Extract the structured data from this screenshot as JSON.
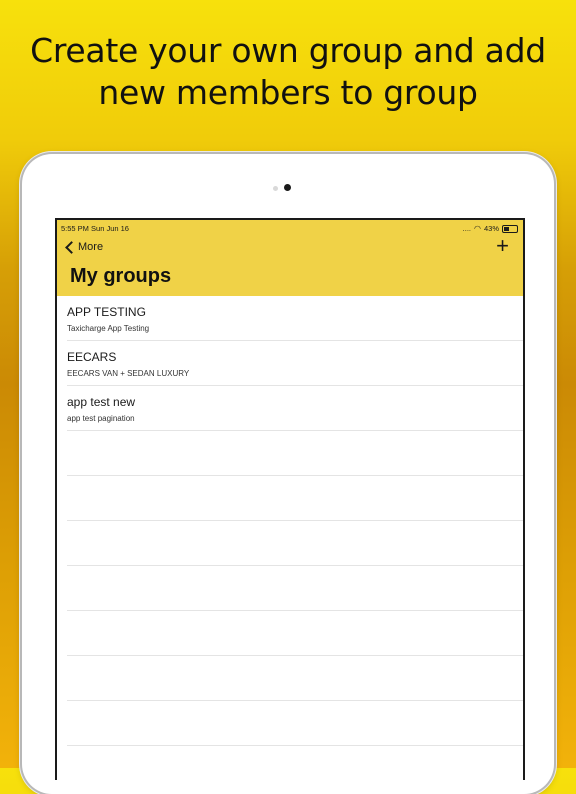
{
  "promo": {
    "line1": "Create your own group and add",
    "line2": "new members to group"
  },
  "status_bar": {
    "time_date": "5:55 PM   Sun Jun 16",
    "battery_percent": "43%",
    "battery_level": 0.43
  },
  "nav": {
    "back_label": "More",
    "add_symbol": "+",
    "title": "My groups",
    "bar_color": "#f0d247"
  },
  "groups": [
    {
      "name": "APP TESTING",
      "description": "Taxicharge App Testing"
    },
    {
      "name": "EECARS",
      "description": "EECARS VAN + SEDAN LUXURY"
    },
    {
      "name": "app test new",
      "description": "app test pagination"
    }
  ]
}
